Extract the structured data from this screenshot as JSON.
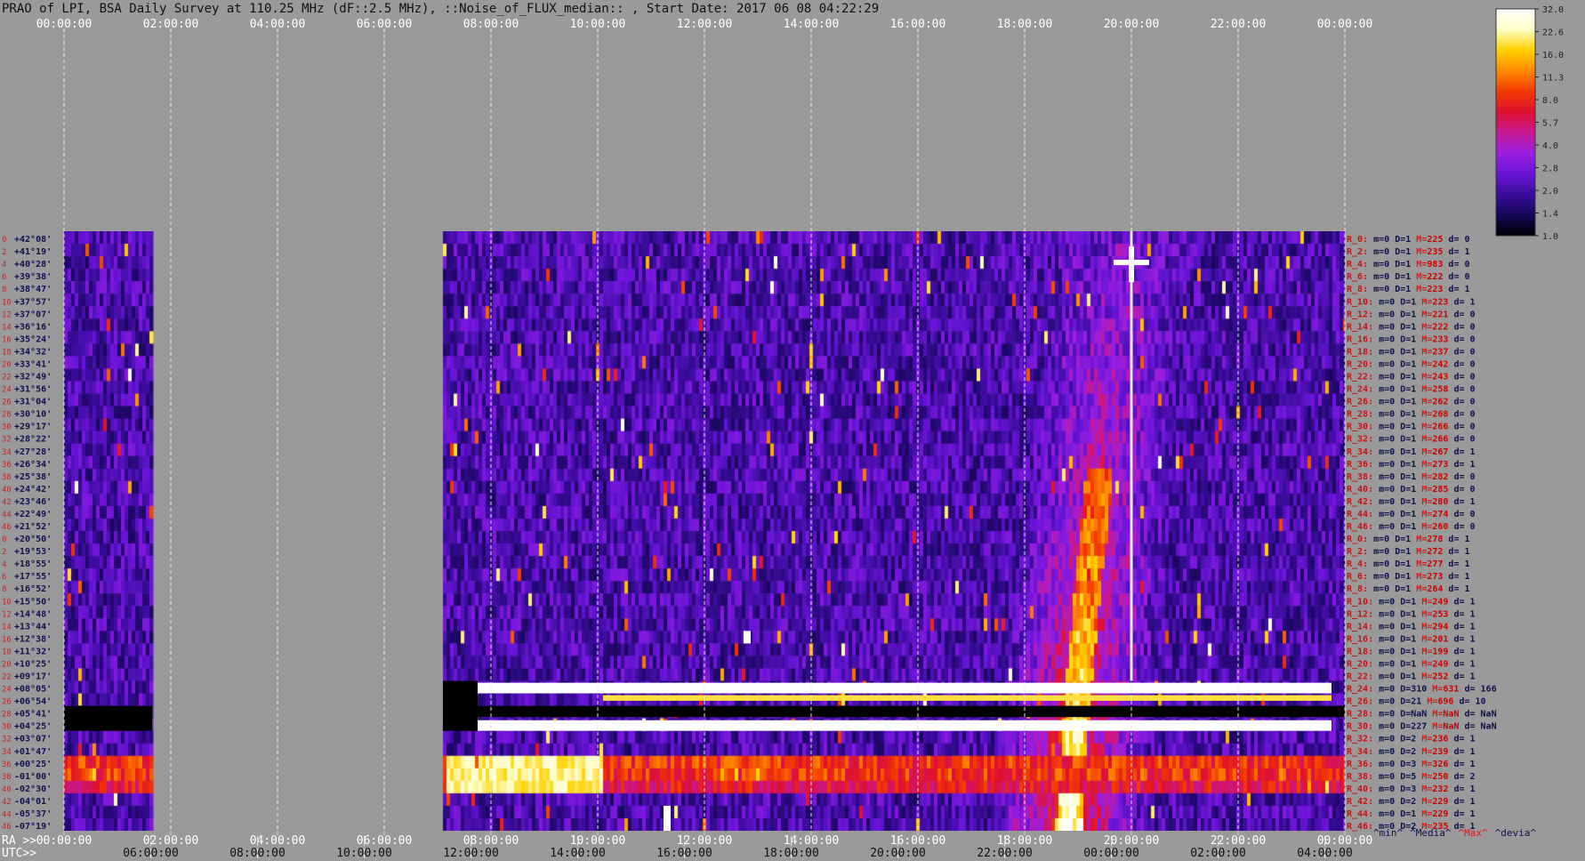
{
  "chart_data": {
    "type": "heatmap",
    "title": "PRAO of LPI, BSA Daily Survey at 110.25 MHz (dF::2.5 MHz), ::Noise_of_FLUX_median:: , Start Date: 2017 06 08 04:22:29",
    "top_axis_ticks": [
      "00:00:00",
      "02:00:00",
      "04:00:00",
      "06:00:00",
      "08:00:00",
      "10:00:00",
      "12:00:00",
      "14:00:00",
      "16:00:00",
      "18:00:00",
      "20:00:00",
      "22:00:00",
      "00:00:00"
    ],
    "bottom_ra_label": "RA >>",
    "bottom_ra_ticks": [
      "00:00:00",
      "02:00:00",
      "04:00:00",
      "06:00:00",
      "08:00:00",
      "10:00:00",
      "12:00:00",
      "14:00:00",
      "16:00:00",
      "18:00:00",
      "20:00:00",
      "22:00:00",
      "00:00:00"
    ],
    "bottom_utc_label": "UTC>>",
    "bottom_utc_ticks": [
      "06:00:00",
      "08:00:00",
      "10:00:00",
      "12:00:00",
      "14:00:00",
      "16:00:00",
      "18:00:00",
      "20:00:00",
      "22:00:00",
      "00:00:00",
      "02:00:00",
      "04:00:00"
    ],
    "row_numbers": [
      "0",
      "2",
      "4",
      "6",
      "8",
      "10",
      "12",
      "14",
      "16",
      "18",
      "20",
      "22",
      "24",
      "26",
      "28",
      "30",
      "32",
      "34",
      "36",
      "38",
      "40",
      "42",
      "44",
      "46",
      "0",
      "2",
      "4",
      "6",
      "8",
      "10",
      "12",
      "14",
      "16",
      "18",
      "20",
      "22",
      "24",
      "26",
      "28",
      "30",
      "32",
      "34",
      "36",
      "38",
      "40",
      "42",
      "44",
      "46"
    ],
    "declinations": [
      "+42°08'",
      "+41°19'",
      "+40°28'",
      "+39°38'",
      "+38°47'",
      "+37°57'",
      "+37°07'",
      "+36°16'",
      "+35°24'",
      "+34°32'",
      "+33°41'",
      "+32°49'",
      "+31°56'",
      "+31°04'",
      "+30°10'",
      "+29°17'",
      "+28°22'",
      "+27°28'",
      "+26°34'",
      "+25°38'",
      "+24°42'",
      "+23°46'",
      "+22°49'",
      "+21°52'",
      "+20°50'",
      "+19°53'",
      "+18°55'",
      "+17°55'",
      "+16°52'",
      "+15°50'",
      "+14°48'",
      "+13°44'",
      "+12°38'",
      "+11°32'",
      "+10°25'",
      "+09°17'",
      "+08°05'",
      "+06°54'",
      "+05°41'",
      "+04°25'",
      "+03°07'",
      "+01°47'",
      "+00°25'",
      "-01°00'",
      "-02°30'",
      "-04°01'",
      "-05°37'",
      "-07°19'"
    ],
    "row_stats": [
      {
        "r": "R_0:",
        "m": "0",
        "d": "1",
        "M": "225",
        "dv": "0"
      },
      {
        "r": "R_2:",
        "m": "0",
        "d": "1",
        "M": "235",
        "dv": "1"
      },
      {
        "r": "R_4:",
        "m": "0",
        "d": "1",
        "M": "983",
        "dv": "0"
      },
      {
        "r": "R_6:",
        "m": "0",
        "d": "1",
        "M": "222",
        "dv": "0"
      },
      {
        "r": "R_8:",
        "m": "0",
        "d": "1",
        "M": "223",
        "dv": "1"
      },
      {
        "r": "R_10:",
        "m": "0",
        "d": "1",
        "M": "223",
        "dv": "1"
      },
      {
        "r": "R_12:",
        "m": "0",
        "d": "1",
        "M": "221",
        "dv": "0"
      },
      {
        "r": "R_14:",
        "m": "0",
        "d": "1",
        "M": "222",
        "dv": "0"
      },
      {
        "r": "R_16:",
        "m": "0",
        "d": "1",
        "M": "233",
        "dv": "0"
      },
      {
        "r": "R_18:",
        "m": "0",
        "d": "1",
        "M": "237",
        "dv": "0"
      },
      {
        "r": "R_20:",
        "m": "0",
        "d": "1",
        "M": "242",
        "dv": "0"
      },
      {
        "r": "R_22:",
        "m": "0",
        "d": "1",
        "M": "243",
        "dv": "0"
      },
      {
        "r": "R_24:",
        "m": "0",
        "d": "1",
        "M": "258",
        "dv": "0"
      },
      {
        "r": "R_26:",
        "m": "0",
        "d": "1",
        "M": "262",
        "dv": "0"
      },
      {
        "r": "R_28:",
        "m": "0",
        "d": "1",
        "M": "268",
        "dv": "0"
      },
      {
        "r": "R_30:",
        "m": "0",
        "d": "1",
        "M": "266",
        "dv": "0"
      },
      {
        "r": "R_32:",
        "m": "0",
        "d": "1",
        "M": "266",
        "dv": "0"
      },
      {
        "r": "R_34:",
        "m": "0",
        "d": "1",
        "M": "267",
        "dv": "1"
      },
      {
        "r": "R_36:",
        "m": "0",
        "d": "1",
        "M": "273",
        "dv": "1"
      },
      {
        "r": "R_38:",
        "m": "0",
        "d": "1",
        "M": "282",
        "dv": "0"
      },
      {
        "r": "R_40:",
        "m": "0",
        "d": "1",
        "M": "285",
        "dv": "0"
      },
      {
        "r": "R_42:",
        "m": "0",
        "d": "1",
        "M": "280",
        "dv": "1"
      },
      {
        "r": "R_44:",
        "m": "0",
        "d": "1",
        "M": "274",
        "dv": "0"
      },
      {
        "r": "R_46:",
        "m": "0",
        "d": "1",
        "M": "260",
        "dv": "0"
      },
      {
        "r": "R_0:",
        "m": "0",
        "d": "1",
        "M": "278",
        "dv": "1"
      },
      {
        "r": "R_2:",
        "m": "0",
        "d": "1",
        "M": "272",
        "dv": "1"
      },
      {
        "r": "R_4:",
        "m": "0",
        "d": "1",
        "M": "277",
        "dv": "1"
      },
      {
        "r": "R_6:",
        "m": "0",
        "d": "1",
        "M": "273",
        "dv": "1"
      },
      {
        "r": "R_8:",
        "m": "0",
        "d": "1",
        "M": "264",
        "dv": "1"
      },
      {
        "r": "R_10:",
        "m": "0",
        "d": "1",
        "M": "249",
        "dv": "1"
      },
      {
        "r": "R_12:",
        "m": "0",
        "d": "1",
        "M": "253",
        "dv": "1"
      },
      {
        "r": "R_14:",
        "m": "0",
        "d": "1",
        "M": "294",
        "dv": "1"
      },
      {
        "r": "R_16:",
        "m": "0",
        "d": "1",
        "M": "201",
        "dv": "1"
      },
      {
        "r": "R_18:",
        "m": "0",
        "d": "1",
        "M": "199",
        "dv": "1"
      },
      {
        "r": "R_20:",
        "m": "0",
        "d": "1",
        "M": "249",
        "dv": "1"
      },
      {
        "r": "R_22:",
        "m": "0",
        "d": "1",
        "M": "252",
        "dv": "1"
      },
      {
        "r": "R_24:",
        "m": "0",
        "d": "310",
        "M": "631",
        "dv": "166"
      },
      {
        "r": "R_26:",
        "m": "0",
        "d": "21",
        "M": "696",
        "dv": "10"
      },
      {
        "r": "R_28:",
        "m": "0",
        "d": "NaN",
        "M": "NaN",
        "dv": "NaN"
      },
      {
        "r": "R_30:",
        "m": "0",
        "d": "227",
        "M": "NaN",
        "dv": "NaN"
      },
      {
        "r": "R_32:",
        "m": "0",
        "d": "2",
        "M": "236",
        "dv": "1"
      },
      {
        "r": "R_34:",
        "m": "0",
        "d": "2",
        "M": "239",
        "dv": "1"
      },
      {
        "r": "R_36:",
        "m": "0",
        "d": "3",
        "M": "326",
        "dv": "1"
      },
      {
        "r": "R_38:",
        "m": "0",
        "d": "5",
        "M": "250",
        "dv": "2"
      },
      {
        "r": "R_40:",
        "m": "0",
        "d": "3",
        "M": "232",
        "dv": "1"
      },
      {
        "r": "R_42:",
        "m": "0",
        "d": "2",
        "M": "229",
        "dv": "1"
      },
      {
        "r": "R_44:",
        "m": "0",
        "d": "1",
        "M": "229",
        "dv": "1"
      },
      {
        "r": "R_46:",
        "m": "0",
        "d": "2",
        "M": "235",
        "dv": "1"
      }
    ],
    "stat_labels": {
      "m": "m=",
      "d": "D=",
      "M": "M=",
      "dv": "d="
    },
    "stats_footer": [
      "^min^",
      "^Media^",
      "^Max^",
      "^devia^"
    ],
    "colorbar_ticks": [
      "32.0",
      "22.6",
      "16.0",
      "11.3",
      "8.0",
      "5.7",
      "4.0",
      "2.8",
      "2.0",
      "1.4",
      "1.0"
    ],
    "colormap": [
      "#000000",
      "#17065a",
      "#3a0c9a",
      "#6a14d8",
      "#9a1ee0",
      "#c81890",
      "#e01030",
      "#f23a00",
      "#ff8a00",
      "#ffd200",
      "#ffffc8",
      "#ffffff"
    ],
    "colors": {
      "background": "#9a9a9a",
      "row_label": "#cc2222",
      "dec_label": "#101050",
      "stat_key": "#cc1111",
      "stat_val": "#101050",
      "stat_max_key": "#ee1111",
      "stat_max_val": "#cc0000"
    },
    "observation_blocks_ra_hours": [
      [
        0.0,
        1.65
      ],
      [
        7.1,
        24.0
      ]
    ],
    "features": {
      "bright_source_ra_hours": 20.0,
      "bright_source_row": 2,
      "diagonal_band_ra_hours": [
        [
          19.8,
          0
        ],
        [
          19.0,
          35
        ],
        [
          18.8,
          47
        ]
      ],
      "saturated_rows": [
        36,
        39
      ],
      "saturated_bar_color": "#ffffff",
      "yellow_band_row": 37,
      "blank_rows": [
        38
      ],
      "hot_rows": [
        42,
        43,
        44
      ]
    }
  }
}
